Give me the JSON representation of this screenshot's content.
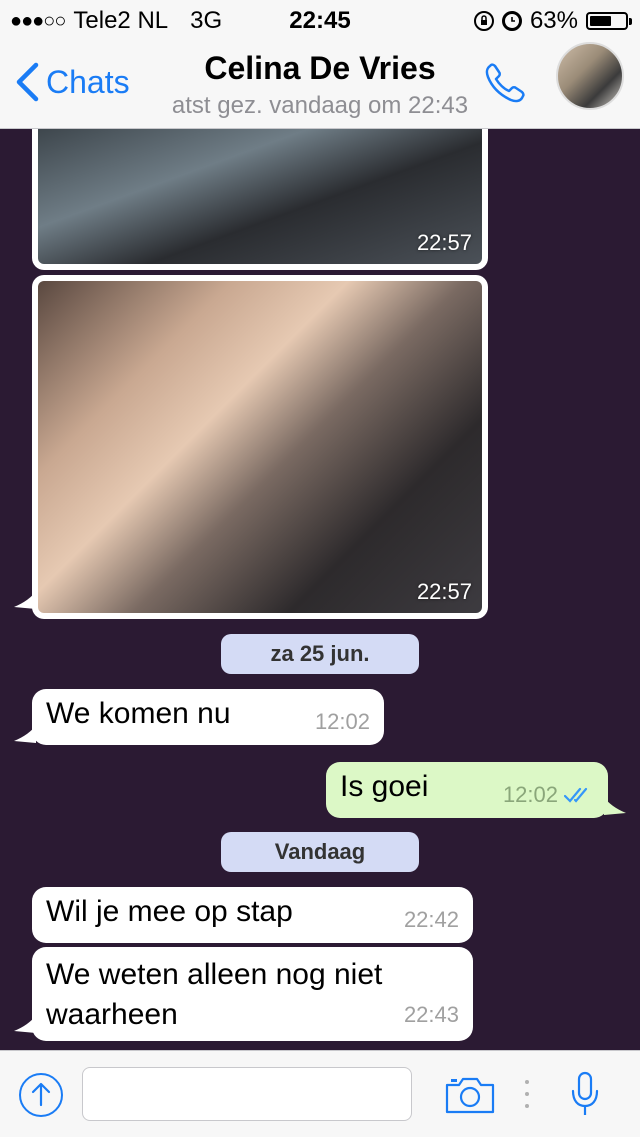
{
  "status_bar": {
    "signal": "●●●○○",
    "carrier": "Tele2 NL",
    "network": "3G",
    "time": "22:45",
    "battery_percent": "63%",
    "battery_level": 0.63
  },
  "nav": {
    "back_label": "Chats",
    "contact_name": "Celina De Vries",
    "last_seen": "atst gez. vandaag om 22:43"
  },
  "messages": {
    "photo1_time": "22:57",
    "photo2_time": "22:57",
    "date1": "za 25 jun.",
    "msg1_text": "We komen nu",
    "msg1_time": "12:02",
    "msg2_text": "Is goei",
    "msg2_time": "12:02",
    "date2": "Vandaag",
    "msg3_text": "Wil je mee op stap",
    "msg3_time": "22:42",
    "msg4_line1": "We weten alleen nog niet",
    "msg4_line2": "waarheen",
    "msg4_time": "22:43"
  },
  "input": {
    "placeholder": ""
  },
  "colors": {
    "chat_background": "#2b1a33",
    "accent_blue": "#1a7cf5",
    "outgoing_bubble": "#dcf8c6",
    "date_pill": "#d4dbf5"
  }
}
